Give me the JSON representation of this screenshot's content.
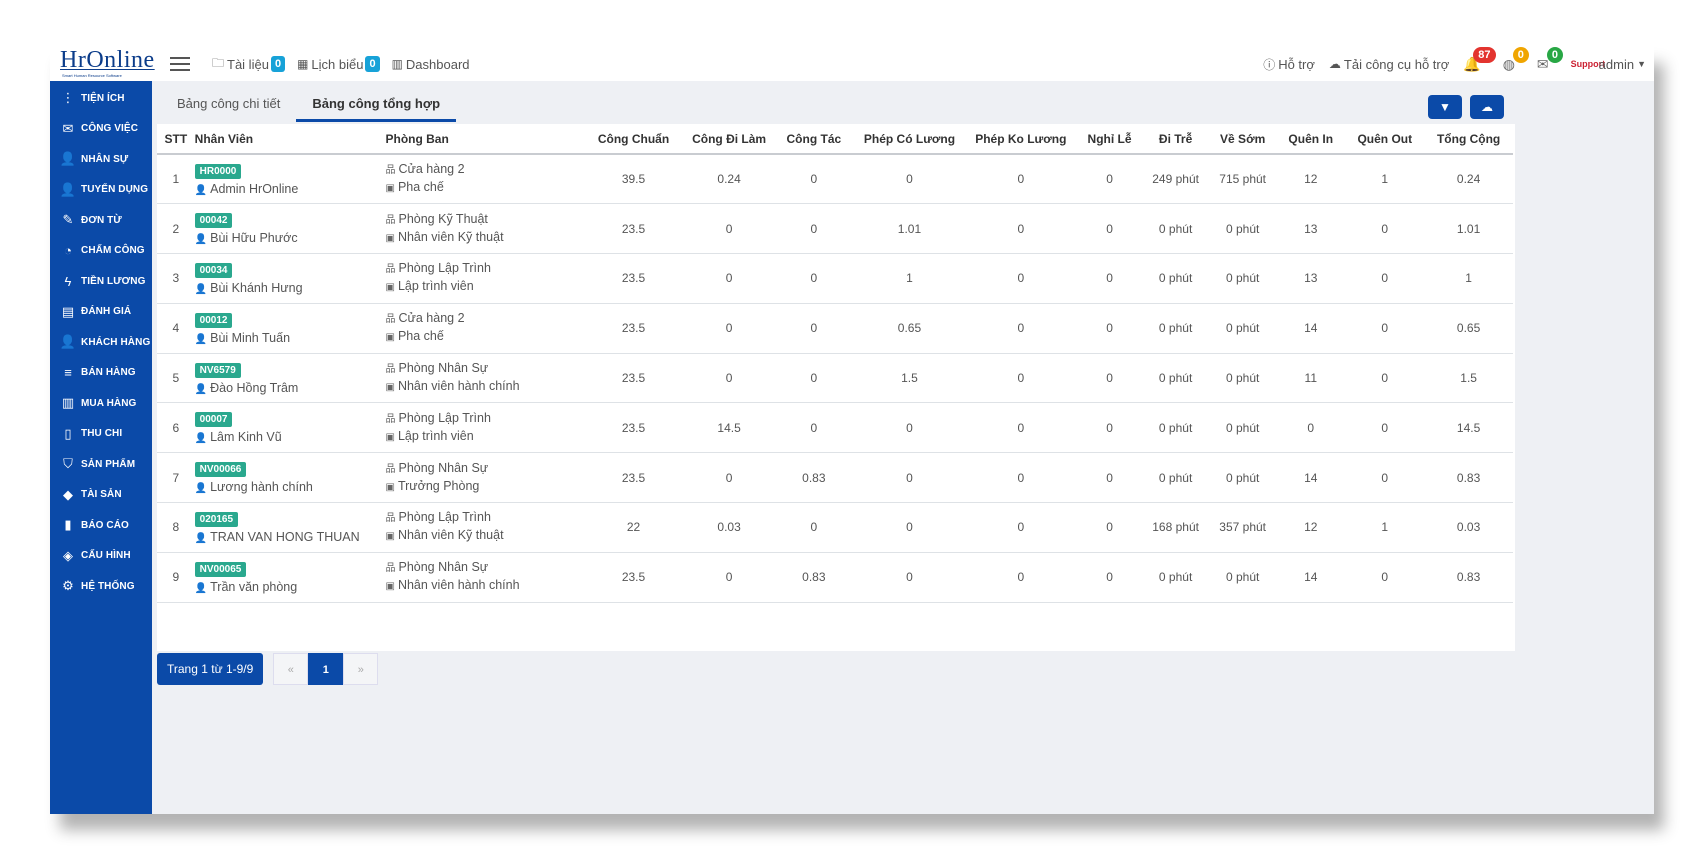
{
  "logo": {
    "main": "HrOnline",
    "sub": "Smart Human Resource Software"
  },
  "topbar": {
    "links": [
      {
        "icon": "folder-icon",
        "label": "Tài liệu",
        "badge": "0"
      },
      {
        "icon": "calendar-icon",
        "label": "Lịch biểu",
        "badge": "0"
      },
      {
        "icon": "bar-chart-icon",
        "label": "Dashboard"
      }
    ],
    "support": "Hỗ trợ",
    "download": "Tải công cụ hỗ trợ",
    "notif_badges": {
      "bell": "87",
      "globe": "0",
      "mail": "0"
    },
    "user": "admin",
    "avatar_text": "Support"
  },
  "sidebar": {
    "items": [
      {
        "label": "TIỆN ÍCH",
        "icon": "⋮"
      },
      {
        "label": "CÔNG VIỆC",
        "icon": "✉"
      },
      {
        "label": "NHÂN SỰ",
        "icon": "👤"
      },
      {
        "label": "TUYỂN DỤNG",
        "icon": "👤"
      },
      {
        "label": "ĐƠN TỪ",
        "icon": "✎"
      },
      {
        "label": "CHẤM CÔNG",
        "icon": "◔"
      },
      {
        "label": "TIỀN LƯƠNG",
        "icon": "ϟ"
      },
      {
        "label": "ĐÁNH GIÁ",
        "icon": "▤"
      },
      {
        "label": "KHÁCH HÀNG",
        "icon": "👤"
      },
      {
        "label": "BÁN HÀNG",
        "icon": "≡"
      },
      {
        "label": "MUA HÀNG",
        "icon": "▥"
      },
      {
        "label": "THU CHI",
        "icon": "▯"
      },
      {
        "label": "SẢN PHẨM",
        "icon": "⛉"
      },
      {
        "label": "TÀI SẢN",
        "icon": "◆"
      },
      {
        "label": "BÁO CÁO",
        "icon": "▮"
      },
      {
        "label": "CẤU HÌNH",
        "icon": "◈"
      },
      {
        "label": "HỆ THỐNG",
        "icon": "⚙"
      }
    ]
  },
  "tabs": [
    "Bảng công chi tiết",
    "Bảng công tổng hợp"
  ],
  "active_tab": 1,
  "table": {
    "headers": [
      "STT",
      "Nhân Viên",
      "Phòng Ban",
      "Công Chuẩn",
      "Công Đi Làm",
      "Công Tác",
      "Phép Có Lương",
      "Phép Ko Lương",
      "Nghỉ Lễ",
      "Đi Trễ",
      "Về Sớm",
      "Quên In",
      "Quên Out",
      "Tổng Cộng"
    ],
    "rows": [
      {
        "stt": "1",
        "code": "HR0000",
        "name": "Admin HrOnline",
        "dept": "Cửa hàng 2",
        "pos": "Pha chế",
        "cong_chuan": "39.5",
        "cong_di_lam": "0.24",
        "cong_tac": "0",
        "phep_co_luong": "0",
        "phep_ko_luong": "0",
        "nghi_le": "0",
        "di_tre": "249 phút",
        "ve_som": "715 phút",
        "quen_in": "12",
        "quen_out": "1",
        "tong_cong": "0.24"
      },
      {
        "stt": "2",
        "code": "00042",
        "name": "Bùi Hữu Phước",
        "dept": "Phòng Kỹ Thuật",
        "pos": "Nhân viên Kỹ thuật",
        "cong_chuan": "23.5",
        "cong_di_lam": "0",
        "cong_tac": "0",
        "phep_co_luong": "1.01",
        "phep_ko_luong": "0",
        "nghi_le": "0",
        "di_tre": "0 phút",
        "ve_som": "0 phút",
        "quen_in": "13",
        "quen_out": "0",
        "tong_cong": "1.01"
      },
      {
        "stt": "3",
        "code": "00034",
        "name": "Bùi Khánh Hưng",
        "dept": "Phòng Lập Trình",
        "pos": "Lập trình viên",
        "cong_chuan": "23.5",
        "cong_di_lam": "0",
        "cong_tac": "0",
        "phep_co_luong": "1",
        "phep_ko_luong": "0",
        "nghi_le": "0",
        "di_tre": "0 phút",
        "ve_som": "0 phút",
        "quen_in": "13",
        "quen_out": "0",
        "tong_cong": "1"
      },
      {
        "stt": "4",
        "code": "00012",
        "name": "Bùi Minh Tuấn",
        "dept": "Cửa hàng 2",
        "pos": "Pha chế",
        "cong_chuan": "23.5",
        "cong_di_lam": "0",
        "cong_tac": "0",
        "phep_co_luong": "0.65",
        "phep_ko_luong": "0",
        "nghi_le": "0",
        "di_tre": "0 phút",
        "ve_som": "0 phút",
        "quen_in": "14",
        "quen_out": "0",
        "tong_cong": "0.65"
      },
      {
        "stt": "5",
        "code": "NV6579",
        "name": "Đào Hồng Trâm",
        "dept": "Phòng Nhân Sự",
        "pos": "Nhân viên hành chính",
        "cong_chuan": "23.5",
        "cong_di_lam": "0",
        "cong_tac": "0",
        "phep_co_luong": "1.5",
        "phep_ko_luong": "0",
        "nghi_le": "0",
        "di_tre": "0 phút",
        "ve_som": "0 phút",
        "quen_in": "11",
        "quen_out": "0",
        "tong_cong": "1.5"
      },
      {
        "stt": "6",
        "code": "00007",
        "name": "Lâm Kinh Vũ",
        "dept": "Phòng Lập Trình",
        "pos": "Lập trình viên",
        "cong_chuan": "23.5",
        "cong_di_lam": "14.5",
        "cong_tac": "0",
        "phep_co_luong": "0",
        "phep_ko_luong": "0",
        "nghi_le": "0",
        "di_tre": "0 phút",
        "ve_som": "0 phút",
        "quen_in": "0",
        "quen_out": "0",
        "tong_cong": "14.5"
      },
      {
        "stt": "7",
        "code": "NV00066",
        "name": "Lương hành chính",
        "dept": "Phòng Nhân Sự",
        "pos": "Trưởng Phòng",
        "cong_chuan": "23.5",
        "cong_di_lam": "0",
        "cong_tac": "0.83",
        "phep_co_luong": "0",
        "phep_ko_luong": "0",
        "nghi_le": "0",
        "di_tre": "0 phút",
        "ve_som": "0 phút",
        "quen_in": "14",
        "quen_out": "0",
        "tong_cong": "0.83"
      },
      {
        "stt": "8",
        "code": "020165",
        "name": "TRAN VAN HONG THUAN",
        "dept": "Phòng Lập Trình",
        "pos": "Nhân viên Kỹ thuật",
        "cong_chuan": "22",
        "cong_di_lam": "0.03",
        "cong_tac": "0",
        "phep_co_luong": "0",
        "phep_ko_luong": "0",
        "nghi_le": "0",
        "di_tre": "168 phút",
        "ve_som": "357 phút",
        "quen_in": "12",
        "quen_out": "1",
        "tong_cong": "0.03"
      },
      {
        "stt": "9",
        "code": "NV00065",
        "name": "Trần văn phòng",
        "dept": "Phòng Nhân Sự",
        "pos": "Nhân viên hành chính",
        "cong_chuan": "23.5",
        "cong_di_lam": "0",
        "cong_tac": "0.83",
        "phep_co_luong": "0",
        "phep_ko_luong": "0",
        "nghi_le": "0",
        "di_tre": "0 phút",
        "ve_som": "0 phút",
        "quen_in": "14",
        "quen_out": "0",
        "tong_cong": "0.83"
      }
    ]
  },
  "pagination": {
    "info": "Trang 1 từ 1-9/9",
    "prev": "«",
    "current": "1",
    "next": "»"
  }
}
